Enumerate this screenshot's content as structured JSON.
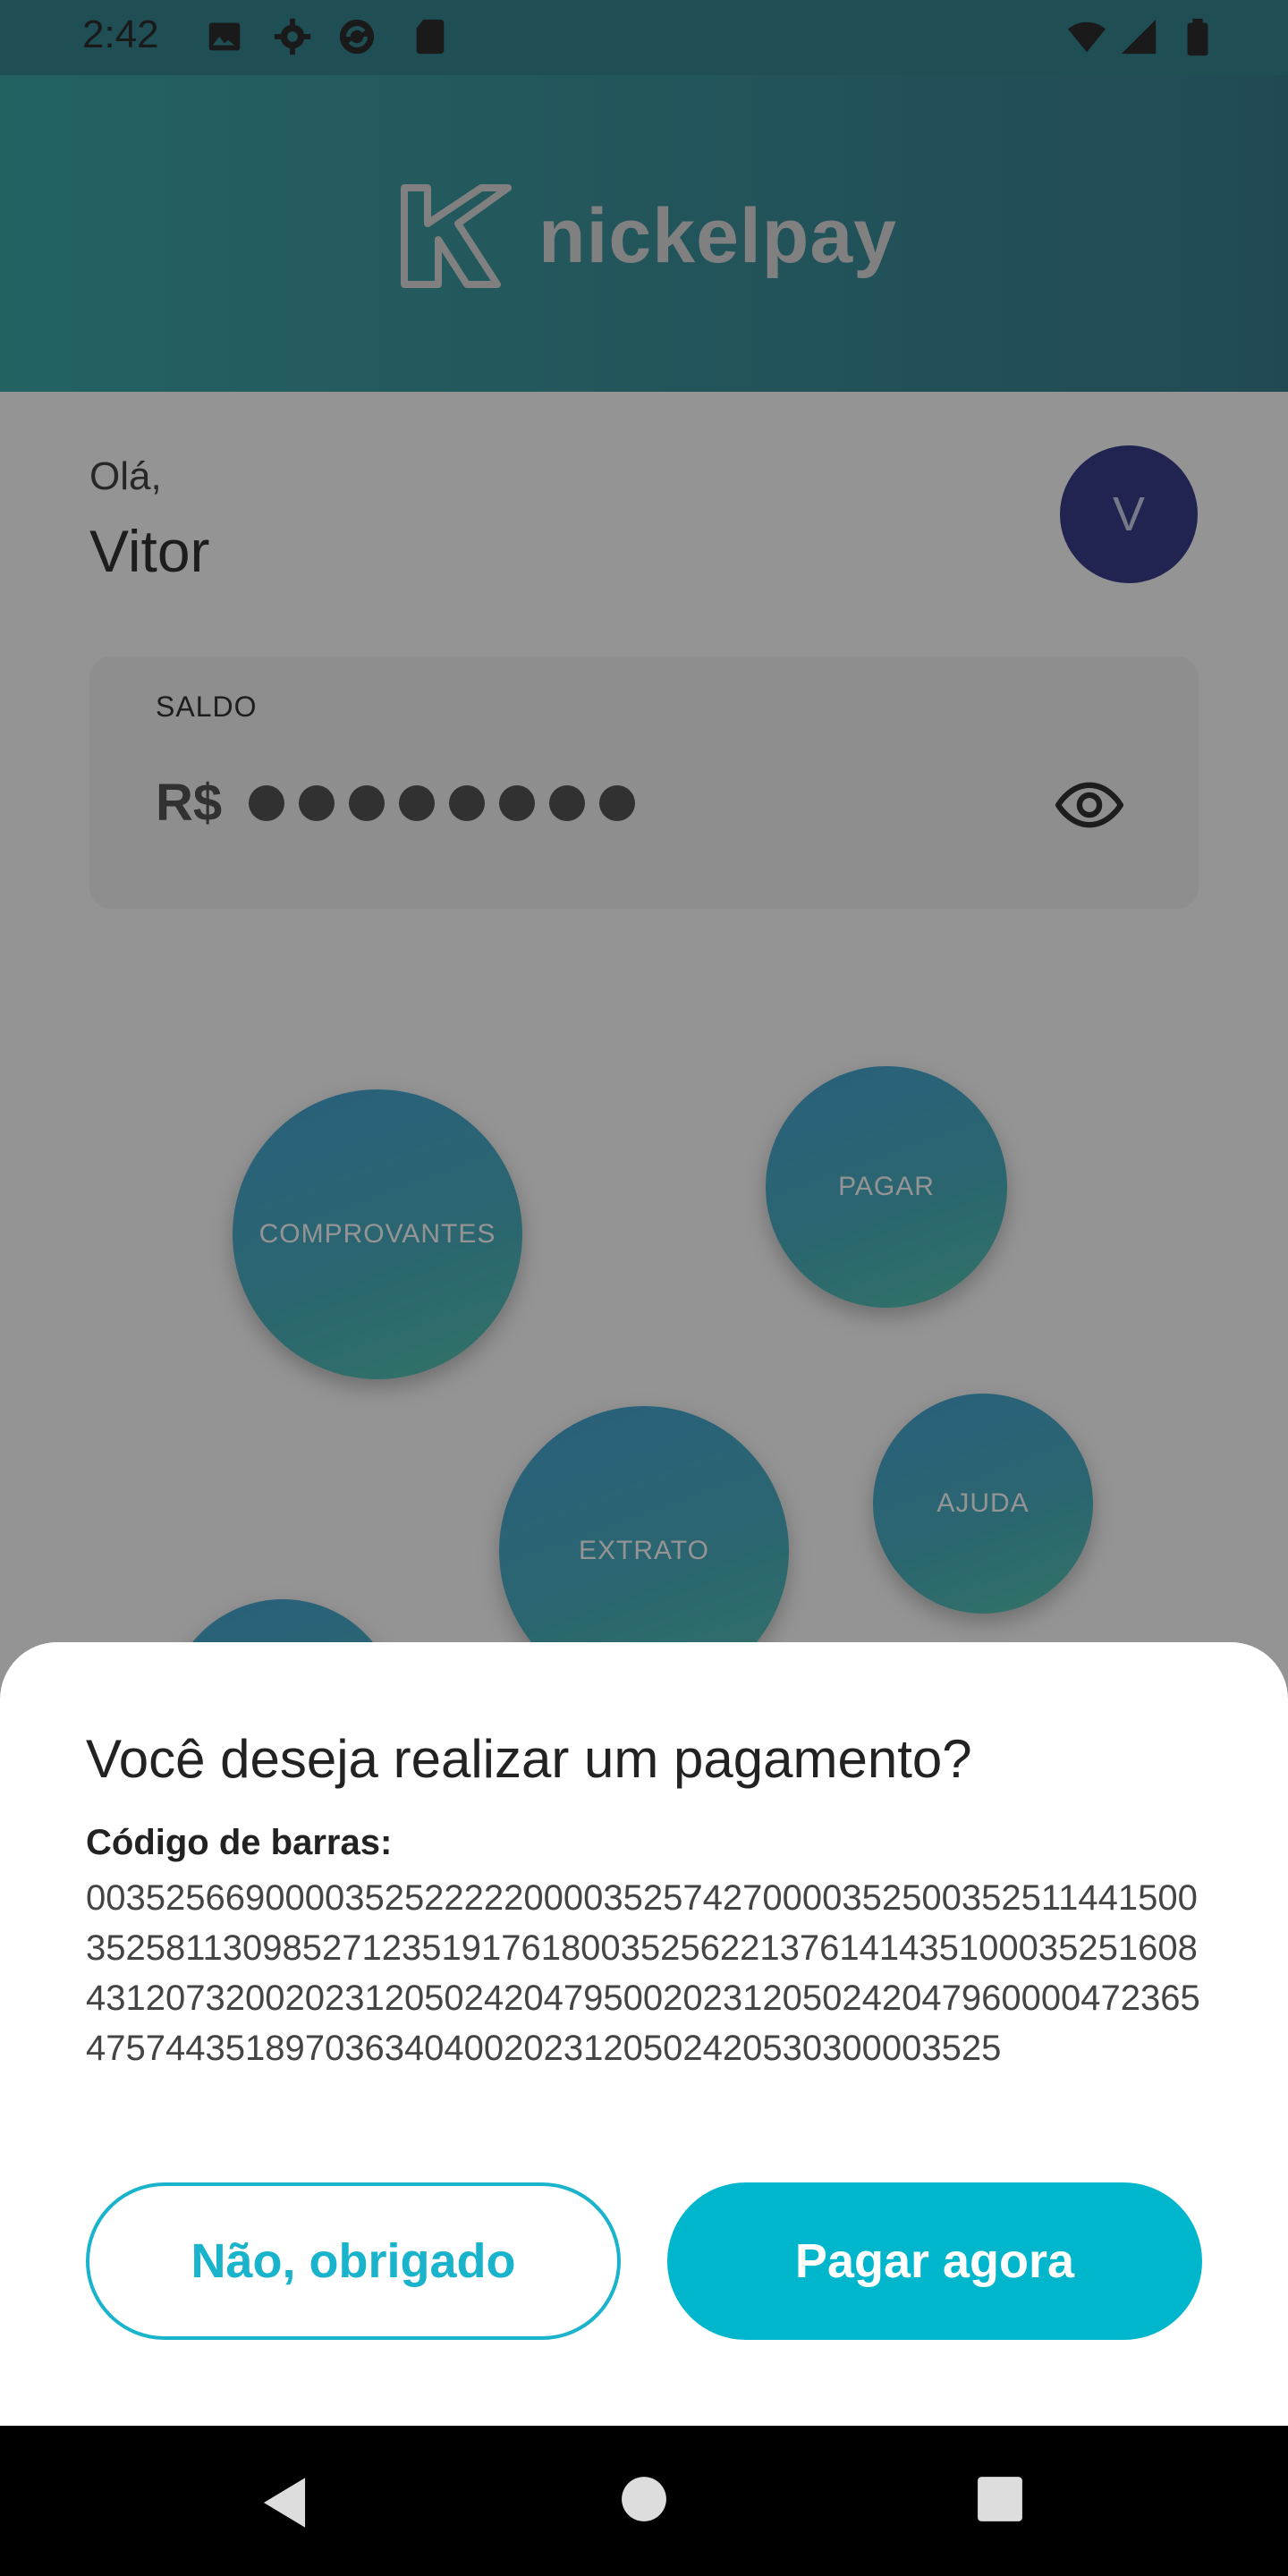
{
  "status_bar": {
    "time": "2:42",
    "icons_left": [
      "image-icon",
      "settings-icon",
      "sync-icon",
      "sd-card-icon"
    ],
    "icons_right": [
      "wifi-icon",
      "signal-icon",
      "battery-icon"
    ]
  },
  "header": {
    "brand": "nickelpay",
    "logo_icon": "nickelpay-k-logo"
  },
  "greeting": {
    "hello": "Olá,",
    "name": "Vitor",
    "avatar_initial": "V"
  },
  "balance": {
    "label": "SALDO",
    "currency": "R$",
    "hidden_dots": 8,
    "toggle_icon": "eye-icon"
  },
  "actions": [
    {
      "id": "comprovantes",
      "label": "COMPROVANTES"
    },
    {
      "id": "pagar",
      "label": "PAGAR"
    },
    {
      "id": "extrato",
      "label": "EXTRATO"
    },
    {
      "id": "ajuda",
      "label": "AJUDA"
    }
  ],
  "dialog": {
    "title": "Você deseja realizar um pagamento?",
    "code_label": "Código de barras:",
    "code_value": "0035256690000352522222000035257427000035250035251144150035258113098527123519176180035256221376141435100035251608431207320020231205024204795002023120502420479600004723654757443518970363404002023120502420530300003525",
    "decline_label": "Não, obrigado",
    "confirm_label": "Pagar agora"
  },
  "nav_bar": {
    "icons": [
      "back-icon",
      "home-icon",
      "recents-icon"
    ]
  },
  "colors": {
    "header_start": "#3fa9aa",
    "header_end": "#3a7f92",
    "accent": "#00b6cc",
    "avatar": "#3a3f8c"
  }
}
